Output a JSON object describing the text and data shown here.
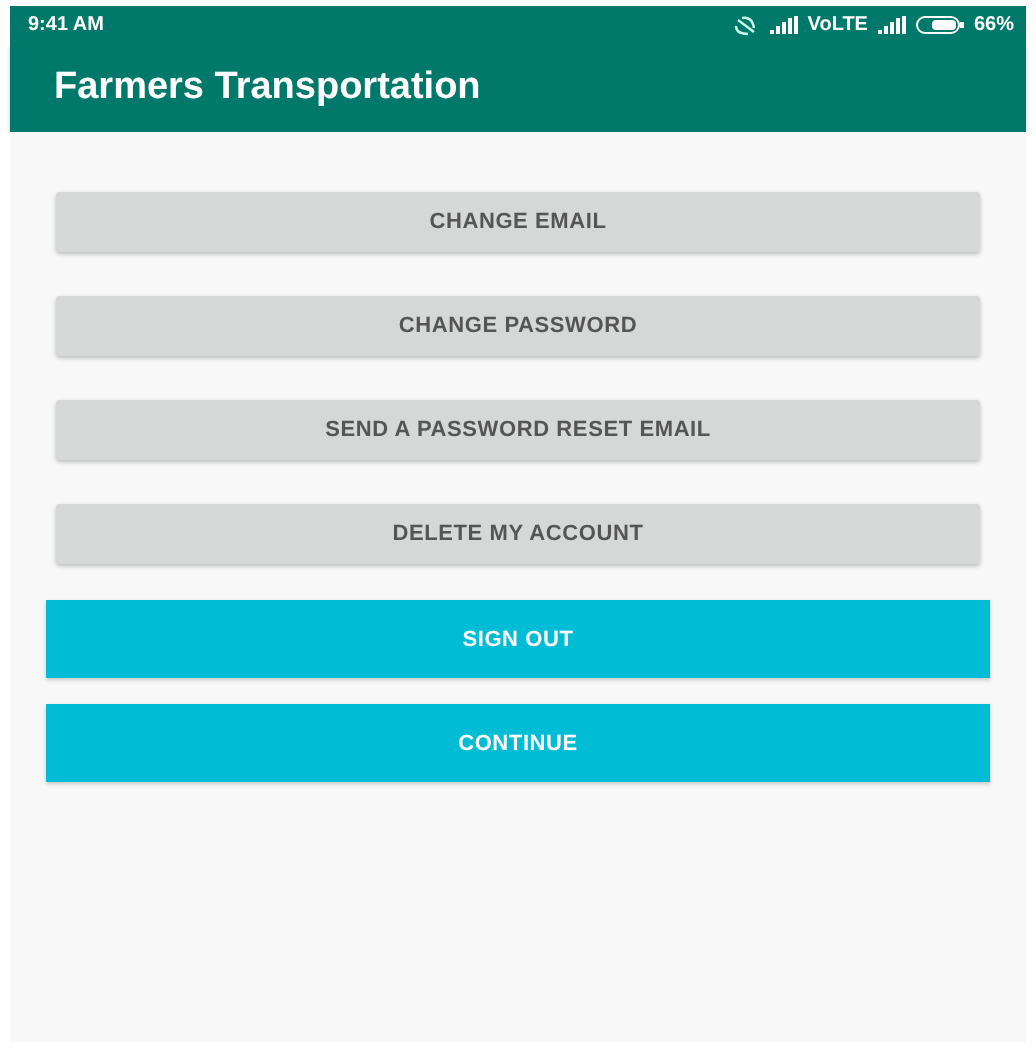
{
  "status_bar": {
    "time": "9:41 AM",
    "network": "VoLTE",
    "battery": "66%"
  },
  "app_bar": {
    "title": "Farmers Transportation"
  },
  "buttons": [
    {
      "label": "CHANGE EMAIL",
      "kind": "secondary"
    },
    {
      "label": "CHANGE PASSWORD",
      "kind": "secondary"
    },
    {
      "label": "SEND A PASSWORD RESET EMAIL",
      "kind": "secondary"
    },
    {
      "label": "DELETE MY ACCOUNT",
      "kind": "secondary"
    },
    {
      "label": "SIGN OUT",
      "kind": "primary"
    },
    {
      "label": "CONTINUE",
      "kind": "primary"
    }
  ]
}
